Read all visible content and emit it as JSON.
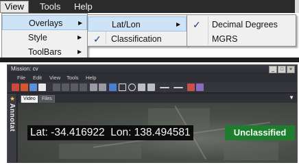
{
  "menubar": {
    "items": [
      {
        "label": "View",
        "active": true
      },
      {
        "label": "Tools",
        "active": false
      },
      {
        "label": "Help",
        "active": false
      }
    ]
  },
  "view_menu": {
    "items": [
      {
        "label": "Overlays",
        "submenu": true,
        "highlighted": true
      },
      {
        "label": "Style",
        "submenu": true,
        "highlighted": false
      },
      {
        "label": "ToolBars",
        "submenu": true,
        "highlighted": false
      }
    ]
  },
  "overlays_menu": {
    "items": [
      {
        "label": "Lat/Lon",
        "checked": false,
        "submenu": true,
        "highlighted": true
      },
      {
        "label": "Classification",
        "checked": true,
        "submenu": false,
        "highlighted": false
      }
    ]
  },
  "latlon_menu": {
    "items": [
      {
        "label": "Decimal Degrees",
        "checked": true
      },
      {
        "label": "MGRS",
        "checked": false
      }
    ]
  },
  "mission_window": {
    "title": "Mission: cv",
    "controls": [
      "_",
      "□",
      "×"
    ],
    "menu": [
      "File",
      "Edit",
      "View",
      "Tools",
      "Help"
    ],
    "tabs": [
      {
        "label": "Video",
        "active": true
      },
      {
        "label": "Files",
        "active": false
      }
    ],
    "collapse_glyph": "▼",
    "sidebar_label": "Annotat",
    "overlay": {
      "coordinates": "Lat: -34.416922  Lon: 138.494581",
      "classification": "Unclassified"
    }
  },
  "colors": {
    "menubar": "#2b2b2b",
    "menu_highlight": "#cfe3f7",
    "classification_badge": "#1e7d2e",
    "coord_box": "#0c0c0c"
  },
  "icons": [
    "checkmark-icon",
    "submenu-arrow-icon",
    "star-icon",
    "collapse-arrow-icon",
    "minimize-icon",
    "maximize-icon",
    "close-icon"
  ]
}
